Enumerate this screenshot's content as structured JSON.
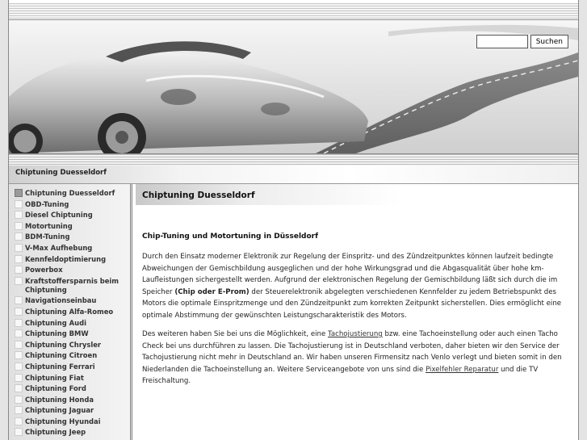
{
  "search": {
    "placeholder": "",
    "button_label": "Suchen"
  },
  "breadcrumb": "Chiptuning Duesseldorf",
  "sidebar": {
    "items": [
      {
        "label": "Chiptuning Duesseldorf",
        "active": true
      },
      {
        "label": "OBD-Tuning"
      },
      {
        "label": "Diesel Chiptuning"
      },
      {
        "label": "Motortuning"
      },
      {
        "label": "BDM-Tuning"
      },
      {
        "label": "V-Max Aufhebung"
      },
      {
        "label": "Kennfeldoptimierung"
      },
      {
        "label": "Powerbox"
      },
      {
        "label": "Kraftstoffersparnis beim Chiptuning"
      },
      {
        "label": "Navigationseinbau"
      },
      {
        "label": "Chiptuning Alfa-Romeo"
      },
      {
        "label": "Chiptuning Audi"
      },
      {
        "label": "Chiptuning BMW"
      },
      {
        "label": "Chiptuning Chrysler"
      },
      {
        "label": "Chiptuning Citroen"
      },
      {
        "label": "Chiptuning Ferrari"
      },
      {
        "label": "Chiptuning Fiat"
      },
      {
        "label": "Chiptuning Ford"
      },
      {
        "label": "Chiptuning Honda"
      },
      {
        "label": "Chiptuning Jaguar"
      },
      {
        "label": "Chiptuning Hyundai"
      },
      {
        "label": "Chiptuning Jeep"
      }
    ]
  },
  "content": {
    "page_title": "Chiptuning Duesseldorf",
    "heading": "Chip-Tuning und Motortuning in Düsseldorf",
    "p1_a": "Durch den Einsatz moderner Elektronik zur Regelung der Einspritz- und des Zündzeitpunktes können laufzeit bedingte Abweichungen der Gemischbildung ausgeglichen und der hohe Wirkungsgrad und die Abgasqualität über hohe km-Laufleistungen sichergestellt werden. Aufgrund der elektronischen Regelung der Gemischbildung läßt sich durch die im Speicher ",
    "p1_bold": "(Chip oder E-Prom)",
    "p1_b": " der Steuerelektronik abgelegten verschiedenen Kennfelder zu jedem Betriebspunkt des Motors die optimale Einspritzmenge und den Zündzeitpunkt zum korrekten Zeitpunkt sicherstellen. Dies ermöglicht eine optimale Abstimmung der gewünschten Leistungscharakteristik des Motors.",
    "p2_a": "Des weiteren haben Sie bei uns die Möglichkeit, eine ",
    "p2_link1": "Tachojustierung",
    "p2_b": " bzw. eine Tachoeinstellung oder auch einen Tacho Check bei uns durchführen zu lassen. Die Tachojustierung ist in Deutschland verboten, daher bieten wir den Service der Tachojustierung nicht mehr in Deutschland an. Wir haben unseren Firmensitz nach Venlo verlegt und bieten somit in den Niederlanden die Tachoeinstellung an. Weitere Serviceangebote von uns sind die ",
    "p2_link2": "Pixelfehler Reparatur",
    "p2_c": " und die TV Freischaltung."
  }
}
